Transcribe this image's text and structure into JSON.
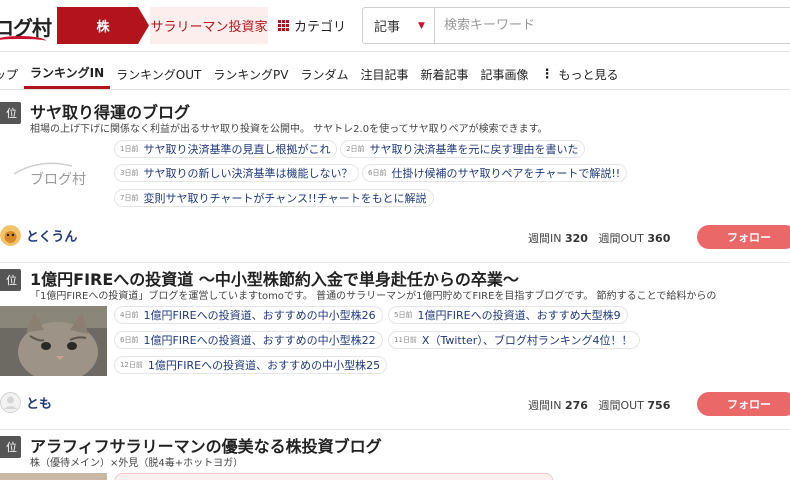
{
  "header": {
    "logo_text": "ログ村",
    "category_label": "株",
    "subcategory_label": "サラリーマン投資家",
    "category_menu_label": "カテゴリ",
    "search": {
      "select_value": "記事",
      "placeholder": "検索キーワード"
    }
  },
  "nav": {
    "items": [
      {
        "label": "ップ"
      },
      {
        "label": "ランキングIN"
      },
      {
        "label": "ランキングOUT"
      },
      {
        "label": "ランキングPV"
      },
      {
        "label": "ランダム"
      },
      {
        "label": "注目記事"
      },
      {
        "label": "新着記事"
      },
      {
        "label": "記事画像"
      }
    ],
    "more_label": "もっと見る",
    "active_index": 1
  },
  "entries": [
    {
      "rank": "位",
      "title": "サヤ取り得運のブログ",
      "description": "相場の上げ下げに関係なく利益が出るサヤ取り投資を公開中。 サヤトレ2.0を使ってサヤ取りペアが検索できます。",
      "thumb_text": "ブログ村",
      "posts": [
        {
          "ago": "1日前",
          "title": "サヤ取り決済基準の見直し根拠がこれ"
        },
        {
          "ago": "2日前",
          "title": "サヤ取り決済基準を元に戻す理由を書いた"
        },
        {
          "ago": "3日前",
          "title": "サヤ取りの新しい決済基準は機能しない？"
        },
        {
          "ago": "6日前",
          "title": "仕掛け候補のサヤ取りペアをチャートで解説!!"
        },
        {
          "ago": "7日前",
          "title": "変則サヤ取りチャートがチャンス!!チャートをもとに解説"
        }
      ],
      "author": "とくうん",
      "in_label": "週間IN",
      "in_value": "320",
      "out_label": "週間OUT",
      "out_value": "360",
      "follow_label": "フォロー"
    },
    {
      "rank": "位",
      "title": "1億円FIREへの投資道 ～中小型株節約入金で単身赴任からの卒業～",
      "description": "「1億円FIREへの投資道」ブログを運営していますtomoです。 普通のサラリーマンが1億円貯めてFIREを目指すブログです。 節約することで給料からの",
      "posts": [
        {
          "ago": "4日前",
          "title": "1億円FIREへの投資道、おすすめの中小型株26"
        },
        {
          "ago": "5日前",
          "title": "1億円FIREへの投資道、おすすめ大型株9"
        },
        {
          "ago": "6日前",
          "title": "1億円FIREへの投資道、おすすめの中小型株22"
        },
        {
          "ago": "11日前",
          "title": "X（Twitter）、ブログ村ランキング4位！！"
        },
        {
          "ago": "12日前",
          "title": "1億円FIREへの投資道、おすすめの中小型株25"
        }
      ],
      "author": "とも",
      "in_label": "週間IN",
      "in_value": "276",
      "out_label": "週間OUT",
      "out_value": "756",
      "follow_label": "フォロー"
    },
    {
      "rank": "位",
      "title": "アラフィフサラリーマンの優美なる株投資ブログ",
      "description": "株（優待メイン）×外見（脱4毒+ホットヨガ）"
    }
  ]
}
